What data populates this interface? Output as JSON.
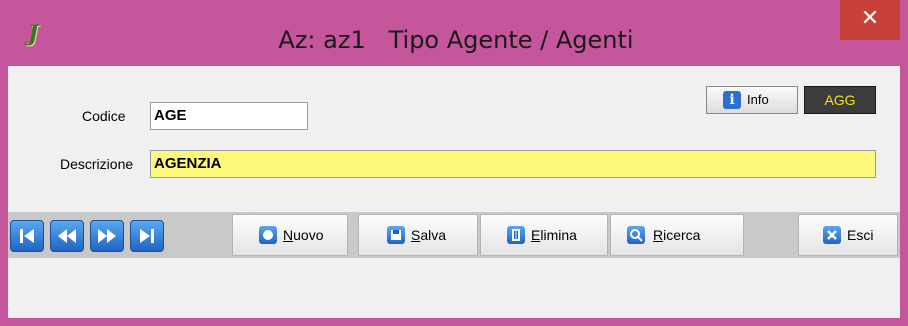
{
  "window": {
    "title": "Az: az1   Tipo Agente / Agenti",
    "app_icon": "J",
    "close_glyph": "✕",
    "accent_color": "#c6569b"
  },
  "form": {
    "codice_label": "Codice",
    "codice_value": "AGE",
    "descrizione_label": "Descrizione",
    "descrizione_value": "AGENZIA",
    "descrizione_bg": "#fdf77a"
  },
  "header_buttons": {
    "info_label": "Info",
    "agg_label": "AGG"
  },
  "toolbar": {
    "nav_buttons": [
      "first-record",
      "previous-record",
      "next-record",
      "last-record"
    ],
    "nuovo_label": "Nuovo",
    "salva_label": "Salva",
    "elimina_label": "Elimina",
    "ricerca_label": "Ricerca",
    "esci_label": "Esci"
  }
}
